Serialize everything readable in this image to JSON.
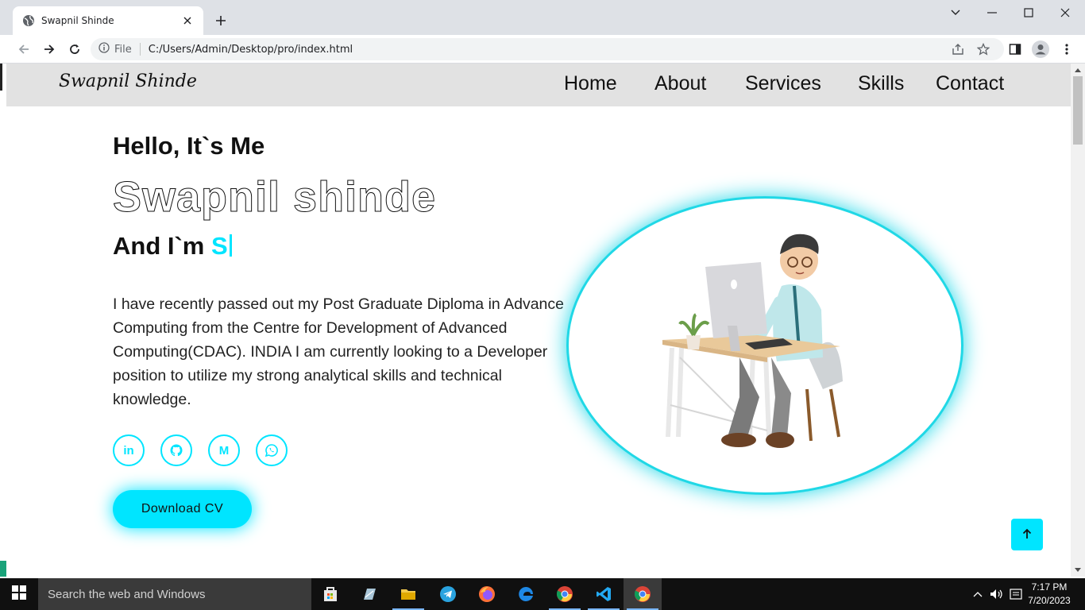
{
  "browser": {
    "tab_title": "Swapnil Shinde",
    "file_label": "File",
    "url": "C:/Users/Admin/Desktop/pro/index.html"
  },
  "site": {
    "logo": "Swapnil Shinde",
    "nav": [
      "Home",
      "About",
      "Services",
      "Skills",
      "Contact"
    ],
    "greeting": "Hello, It`s Me",
    "name": "Swapnil shinde",
    "role_prefix": "And I`m",
    "role_typed": "S",
    "description": "I have recently passed out my Post Graduate Diploma in Advance Computing from the Centre for Development of Advanced Computing(CDAC). INDIA I am currently looking to a Developer position to utilize my strong analytical skills and technical knowledge.",
    "socials": [
      {
        "icon": "linkedin-icon",
        "glyph": "in"
      },
      {
        "icon": "github-icon",
        "glyph": ""
      },
      {
        "icon": "gmail-icon",
        "glyph": "M"
      },
      {
        "icon": "whatsapp-icon",
        "glyph": ""
      }
    ],
    "cv_button": "Download CV",
    "accent_color": "#00e5ff"
  },
  "taskbar": {
    "search_placeholder": "Search the web and Windows",
    "time": "7:17 PM",
    "date": "7/20/2023"
  }
}
